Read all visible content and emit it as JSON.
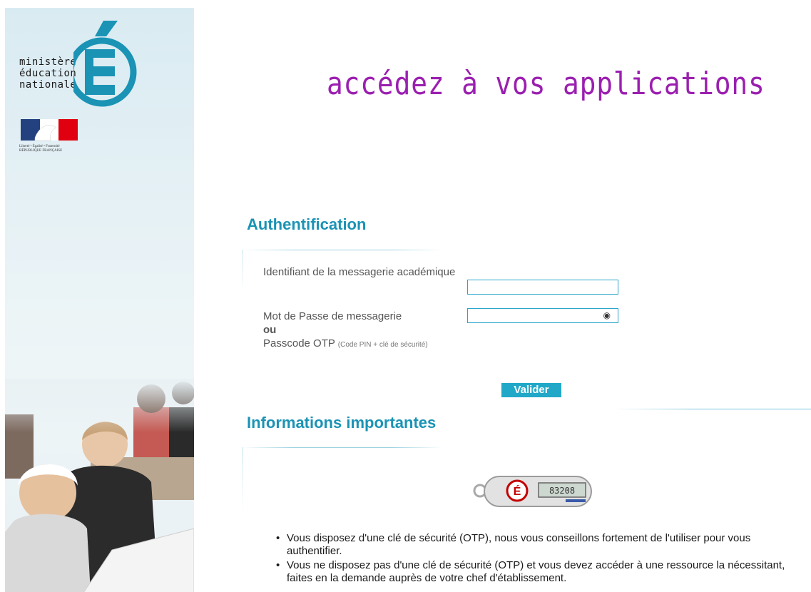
{
  "brand": {
    "logo_lines": [
      "ministère",
      "éducation",
      "nationale"
    ],
    "republic_motto": "Liberté • Égalité • Fraternité",
    "republic_name": "RÉPUBLIQUE FRANÇAISE",
    "accent_color": "#1a93b5",
    "headline_color": "#9b1fb0"
  },
  "headline": "accédez à vos applications",
  "auth": {
    "title": "Authentification",
    "login_label": "Identifiant de la messagerie académique",
    "password_label": "Mot de Passe de messagerie",
    "or_label": "ou",
    "otp_label": "Passcode OTP",
    "otp_hint": "(Code PIN + clé de sécurité)",
    "login_value": "",
    "password_value": "",
    "submit_label": "Valider"
  },
  "info": {
    "title": "Informations importantes",
    "otp_display": "83208",
    "items": [
      "Vous disposez d'une clé de sécurité (OTP), nous vous conseillons fortement de l'utiliser pour vous authentifier.",
      "Vous ne disposez pas d'une clé de sécurité (OTP) et vous devez accéder à une ressource la nécessitant, faites en la demande auprès de votre chef d'établissement."
    ]
  }
}
